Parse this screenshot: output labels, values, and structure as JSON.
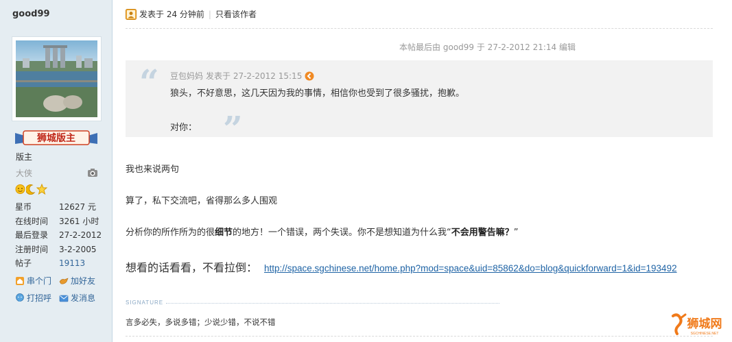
{
  "user": {
    "name": "good99",
    "badge_text": "狮城版主",
    "role": "版主",
    "rank": "大侠",
    "medal_icons": [
      "sun-icon",
      "moon-icon",
      "star-icon"
    ],
    "stats": [
      {
        "label": "星币",
        "value": "12627 元",
        "link": false
      },
      {
        "label": "在线时间",
        "value": "3261 小时",
        "link": false
      },
      {
        "label": "最后登录",
        "value": "27-2-2012",
        "link": false
      },
      {
        "label": "注册时间",
        "value": "3-2-2005",
        "link": false
      },
      {
        "label": "帖子",
        "value": "19113",
        "link": true
      }
    ],
    "actions": [
      {
        "label": "串个门",
        "icon": "home-icon"
      },
      {
        "label": "加好友",
        "icon": "add-friend-icon"
      },
      {
        "label": "打招呼",
        "icon": "greet-icon"
      },
      {
        "label": "发消息",
        "icon": "message-icon"
      }
    ]
  },
  "post": {
    "posted_time": "发表于 24 分钟前",
    "separator": "|",
    "only_author": "只看该作者",
    "edit_note": "本帖最后由 good99 于 27-2-2012 21:14 编辑",
    "quote": {
      "author": "豆包妈妈",
      "time": "发表于 27-2-2012 15:15",
      "line1": "狼头，不好意思，这几天因为我的事情，相信你也受到了很多骚扰，抱歉。",
      "line2": "对你："
    },
    "p1": "我也来说两句",
    "p2": "算了，私下交流吧，省得那么多人围观",
    "p3_a": "分析你的所作所为的很",
    "p3_b": "细节",
    "p3_c": "的地方！一个错误，两个失误。你不是想知道为什么我“",
    "p3_d": "不会用警告嘛？",
    "p3_e": "”",
    "p4_text": "想看的话看看，不看拉倒：",
    "p4_link": "http://space.sgchinese.net/home.php?mod=space&uid=85862&do=blog&quickforward=1&id=193492",
    "signature_label": "SIGNATURE",
    "signature": "言多必失，多说多错；少说少错，不说不错"
  },
  "watermark": {
    "text": "狮城网",
    "sub": "SGCHINESE.NET"
  },
  "colors": {
    "sidebar_bg": "#e5edf2",
    "link": "#336699",
    "quote_bg": "#f2f2f2",
    "watermark": "#f07a1a"
  }
}
